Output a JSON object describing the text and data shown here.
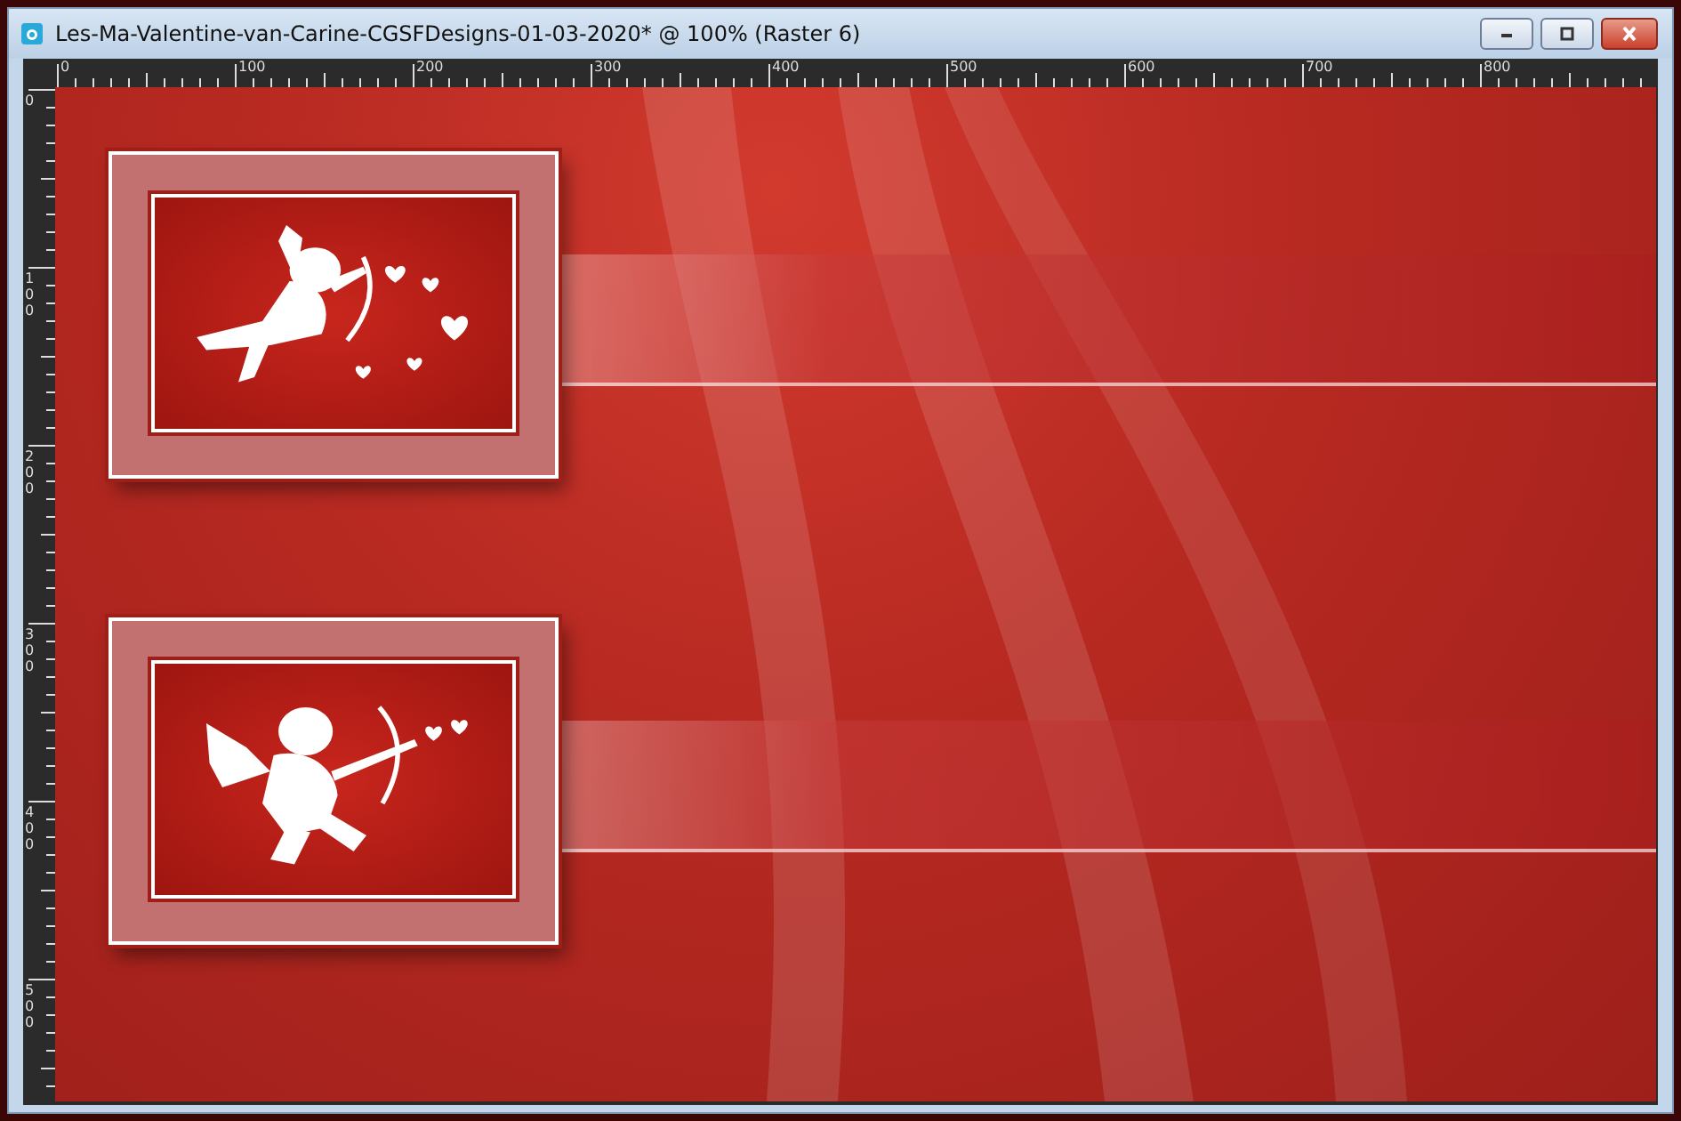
{
  "window": {
    "title": "Les-Ma-Valentine-van-Carine-CGSFDesigns-01-03-2020* @ 100% (Raster 6)"
  },
  "ruler_top": {
    "labels": [
      "0",
      "100",
      "200",
      "300",
      "400",
      "500",
      "600",
      "700",
      "800"
    ]
  },
  "ruler_left": {
    "labels": [
      "0",
      "100",
      "200",
      "300",
      "400",
      "500"
    ]
  },
  "canvas": {
    "framed_pictures": [
      {
        "kind": "flying-cupid"
      },
      {
        "kind": "archer-cupid"
      }
    ]
  }
}
